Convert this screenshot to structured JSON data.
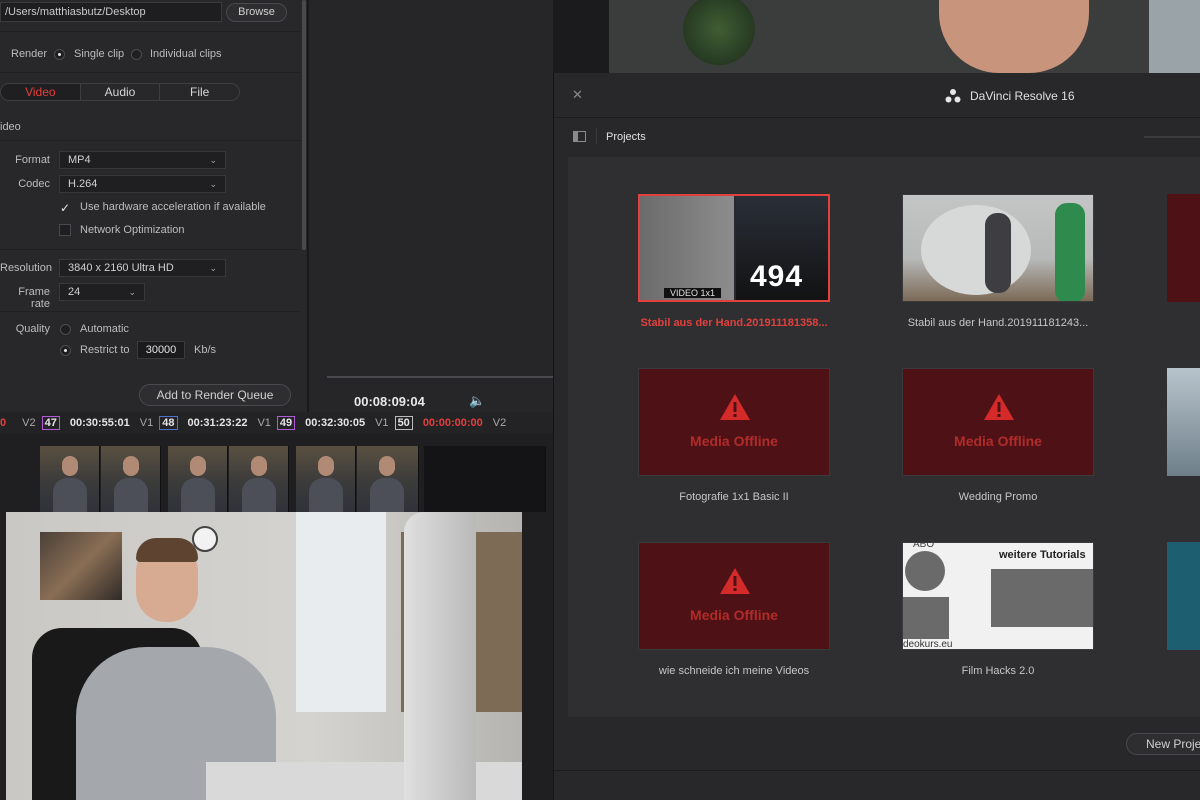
{
  "render": {
    "location_path": "/Users/matthiasbutz/Desktop",
    "browse_label": "Browse",
    "render_label": "Render",
    "single_clip": "Single clip",
    "individual_clips": "Individual clips",
    "tabs": [
      "Video",
      "Audio",
      "File"
    ],
    "video_section": "ideo",
    "format_label": "Format",
    "format_value": "MP4",
    "codec_label": "Codec",
    "codec_value": "H.264",
    "hw_accel": "Use hardware acceleration if available",
    "network_opt": "Network Optimization",
    "resolution_label": "Resolution",
    "resolution_value": "3840 x 2160 Ultra HD",
    "framerate_label": "Frame rate",
    "framerate_value": "24",
    "quality_label": "Quality",
    "automatic": "Automatic",
    "restrict_to": "Restrict to",
    "bitrate": "30000",
    "bitrate_unit": "Kb/s",
    "add_queue": "Add to Render Queue"
  },
  "viewer": {
    "timecode": "00:08:09:04"
  },
  "timeline": {
    "segments": [
      {
        "track": "V2",
        "num": "47",
        "time": "00:30:55:01",
        "color": "#b15bd6"
      },
      {
        "track": "V1",
        "num": "48",
        "time": "00:31:23:22",
        "color": "#4e6fd6"
      },
      {
        "track": "V1",
        "num": "49",
        "time": "00:32:30:05",
        "color": "#b15bd6"
      },
      {
        "track": "V1",
        "num": "50",
        "time": "00:00:00:00",
        "color": "#bbbbbb"
      }
    ],
    "start_marker": "0",
    "end_track": "V2"
  },
  "project_manager": {
    "title": "DaVinci Resolve 16",
    "projects_label": "Projects",
    "media_offline": "Media Offline",
    "new_project": "New Projec",
    "cards": [
      {
        "name": "Stabil aus der Hand.201911181358..."
      },
      {
        "name": "Stabil aus der Hand.201911181243..."
      },
      {
        "name": "Fotografie 1x1 Basic II"
      },
      {
        "name": "Wedding Promo"
      },
      {
        "name": "wie schneide ich meine Videos"
      },
      {
        "name": "Film Hacks 2.0"
      }
    ],
    "thumb_texts": {
      "video_1x1": "VIDEO 1x1",
      "big_numbers": "494",
      "weitere": "weitere Tutorials",
      "abo": "ABO",
      "kurs": "deokurs.eu"
    }
  },
  "colors": {
    "accent_red": "#e2403c",
    "offline_bg": "#4e1216",
    "panel_bg": "#28282b"
  }
}
